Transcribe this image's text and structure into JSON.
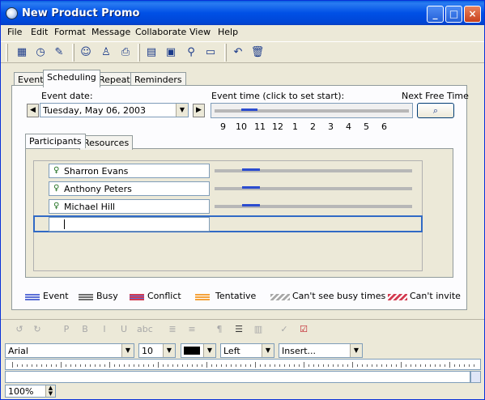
{
  "window": {
    "title": "New Product Promo"
  },
  "menu": [
    "File",
    "Edit",
    "Format",
    "Message",
    "Collaborate",
    "View",
    "Help"
  ],
  "tabs": [
    {
      "label": "Event",
      "active": false
    },
    {
      "label": "Scheduling",
      "active": true
    },
    {
      "label": "Repeat",
      "active": false
    },
    {
      "label": "Reminders",
      "active": false
    }
  ],
  "scheduling": {
    "event_date_label": "Event date:",
    "event_date_value": "Tuesday, May 06, 2003",
    "event_time_label": "Event time (click to set start):",
    "next_free_label": "Next Free Time",
    "hours": [
      "9",
      "10",
      "11",
      "12",
      "1",
      "2",
      "3",
      "4",
      "5",
      "6"
    ]
  },
  "subtabs": [
    {
      "label": "Participants",
      "active": true
    },
    {
      "label": "Resources",
      "active": false
    }
  ],
  "participants": [
    "Sharron Evans",
    "Anthony Peters",
    "Michael Hill"
  ],
  "legend": [
    {
      "label": "Event",
      "color": "#5b6fd6"
    },
    {
      "label": "Busy",
      "color": "#6d6d6d"
    },
    {
      "label": "Conflict",
      "color": "#d33c52"
    },
    {
      "label": "Tentative",
      "color": "#f5a23a"
    },
    {
      "label": "Can't see busy times",
      "color": "#a8a8a8"
    },
    {
      "label": "Can't invite",
      "color": "#d33c52"
    }
  ],
  "format": {
    "font": "Arial",
    "size": "10",
    "align": "Left",
    "insert": "Insert..."
  },
  "zoom": "100%"
}
